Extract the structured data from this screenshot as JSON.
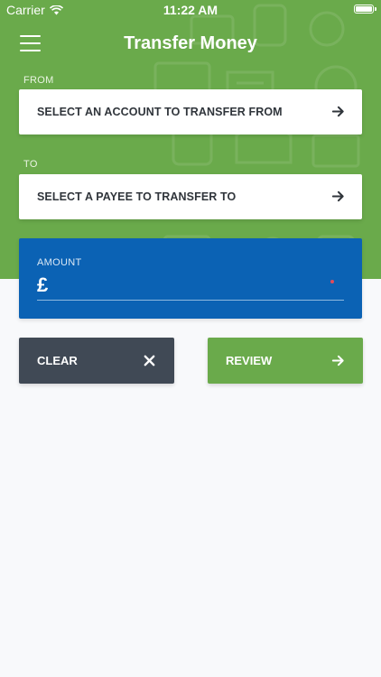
{
  "status_bar": {
    "carrier": "Carrier",
    "time": "11:22 AM"
  },
  "header": {
    "title": "Transfer Money"
  },
  "from": {
    "label": "FROM",
    "placeholder": "SELECT AN ACCOUNT TO TRANSFER FROM"
  },
  "to": {
    "label": "TO",
    "placeholder": "SELECT A PAYEE TO TRANSFER TO"
  },
  "amount": {
    "label": "AMOUNT",
    "currency_symbol": "£",
    "value": ""
  },
  "actions": {
    "clear_label": "CLEAR",
    "review_label": "REVIEW"
  },
  "colors": {
    "brand_green": "#6aaa4b",
    "amount_blue": "#0b62b4",
    "clear_dark": "#404955",
    "background": "#f8f9fb"
  }
}
